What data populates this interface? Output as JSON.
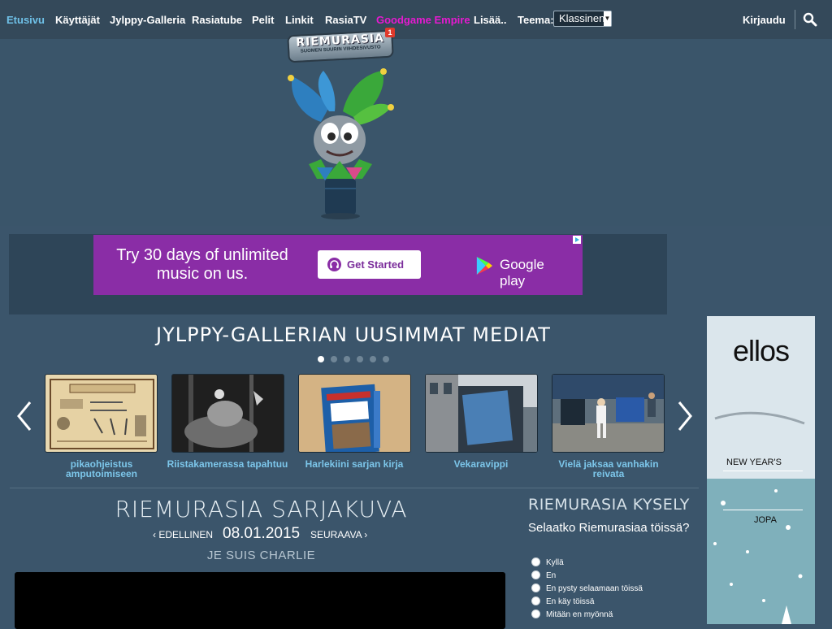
{
  "nav": {
    "items": [
      {
        "label": "Etusivu",
        "state": "active"
      },
      {
        "label": "Käyttäjät"
      },
      {
        "label": "Jylppy-Galleria"
      },
      {
        "label": "Rasiatube"
      },
      {
        "label": "Pelit"
      },
      {
        "label": "Linkit"
      },
      {
        "label": "RasiaTV"
      },
      {
        "label": "Goodgame Empire",
        "state": "special"
      },
      {
        "label": "Lisää.."
      }
    ],
    "theme_label": "Teema:",
    "theme_value": "Klassinen",
    "login": "Kirjaudu",
    "search_icon": "search-icon"
  },
  "logo": {
    "name": "RIEMURASIA",
    "tagline": "SUOMEN SUURIN VIIHDESIVUSTO",
    "badge_count": "1"
  },
  "ad": {
    "text": "Try 30 days of unlimited music on us.",
    "button": "Get Started",
    "store": "Google play",
    "bg_color": "#8a2da6"
  },
  "gallery": {
    "title": "JYLPPY-GALLERIAN UUSIMMAT MEDIAT",
    "dots_total": 6,
    "dots_active_index": 0,
    "items": [
      {
        "caption": "pikaohjeistus amputoimiseen"
      },
      {
        "caption": "Riistakamerassa tapahtuu"
      },
      {
        "caption": "Harlekiini sarjan kirja"
      },
      {
        "caption": "Vekaravippi"
      },
      {
        "caption": "Vielä jaksaa vanhakin reivata"
      }
    ]
  },
  "comic": {
    "title": "RIEMURASIA SARJAKUVA",
    "prev": "EDELLINEN",
    "date": "08.01.2015",
    "next": "SEURAAVA",
    "name": "JE SUIS CHARLIE"
  },
  "poll": {
    "title": "RIEMURASIA KYSELY",
    "question": "Selaatko Riemurasiaa töissä?",
    "options": [
      "Kyllä",
      "En",
      "En pysty selaamaan töissä",
      "En käy töissä",
      "Mitään en myönnä"
    ]
  },
  "side_ad": {
    "brand": "ellos",
    "line1": "NEW YEAR'S",
    "line2": "JOPA"
  }
}
